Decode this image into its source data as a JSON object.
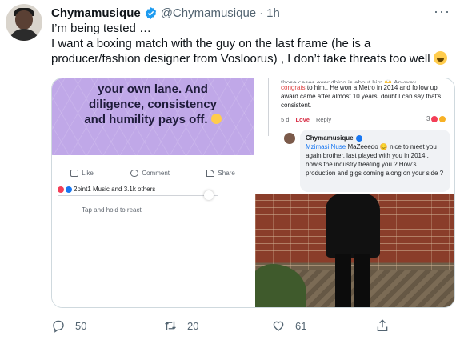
{
  "tweet": {
    "name": "Chymamusique",
    "handle": "@Chymamusique",
    "separator": "·",
    "time": "1h",
    "more": "···",
    "line1": "I’m being tested …",
    "line2": "I want a boxing match with the guy on the last frame (he is a producer/fashion designer from Vosloorus) , I don’t take threats too well",
    "emoji_icon": "sweat-smile-emoji"
  },
  "media": {
    "post": {
      "banner_line1": "your own lane. And",
      "banner_line2": "diligence, consistency",
      "banner_line3": "and humility pays off.",
      "like": "Like",
      "comment": "Comment",
      "share": "Share",
      "reactions": "2pint1 Music and 3.1k others",
      "hold_hint": "Tap and hold to react"
    },
    "comments": {
      "cut_line": "those cases everything is about him 🙌 Anyway",
      "c1_part1": "congrats",
      "c1_part2": " to him.. He won a Metro in 2014 and follow up award came after almost 10 years, doubt I can say that's consistent.",
      "age": "5 d",
      "love": "Love",
      "reply": "Reply",
      "react_count": "3",
      "c2_name": "Chymamusique",
      "c2_mention": "Mzimasi Nuse",
      "c2_text": " MaZeeedo 😊 nice to meet you again brother, last played with you in 2014 , how’s the industry treating you ? How’s production and gigs coming along on your side ?"
    }
  },
  "actions": {
    "replies": "50",
    "retweets": "20",
    "likes": "61"
  },
  "colors": {
    "verified": "#1d9bf0",
    "banner": "#c0a8e8",
    "text_secondary": "#536471"
  }
}
